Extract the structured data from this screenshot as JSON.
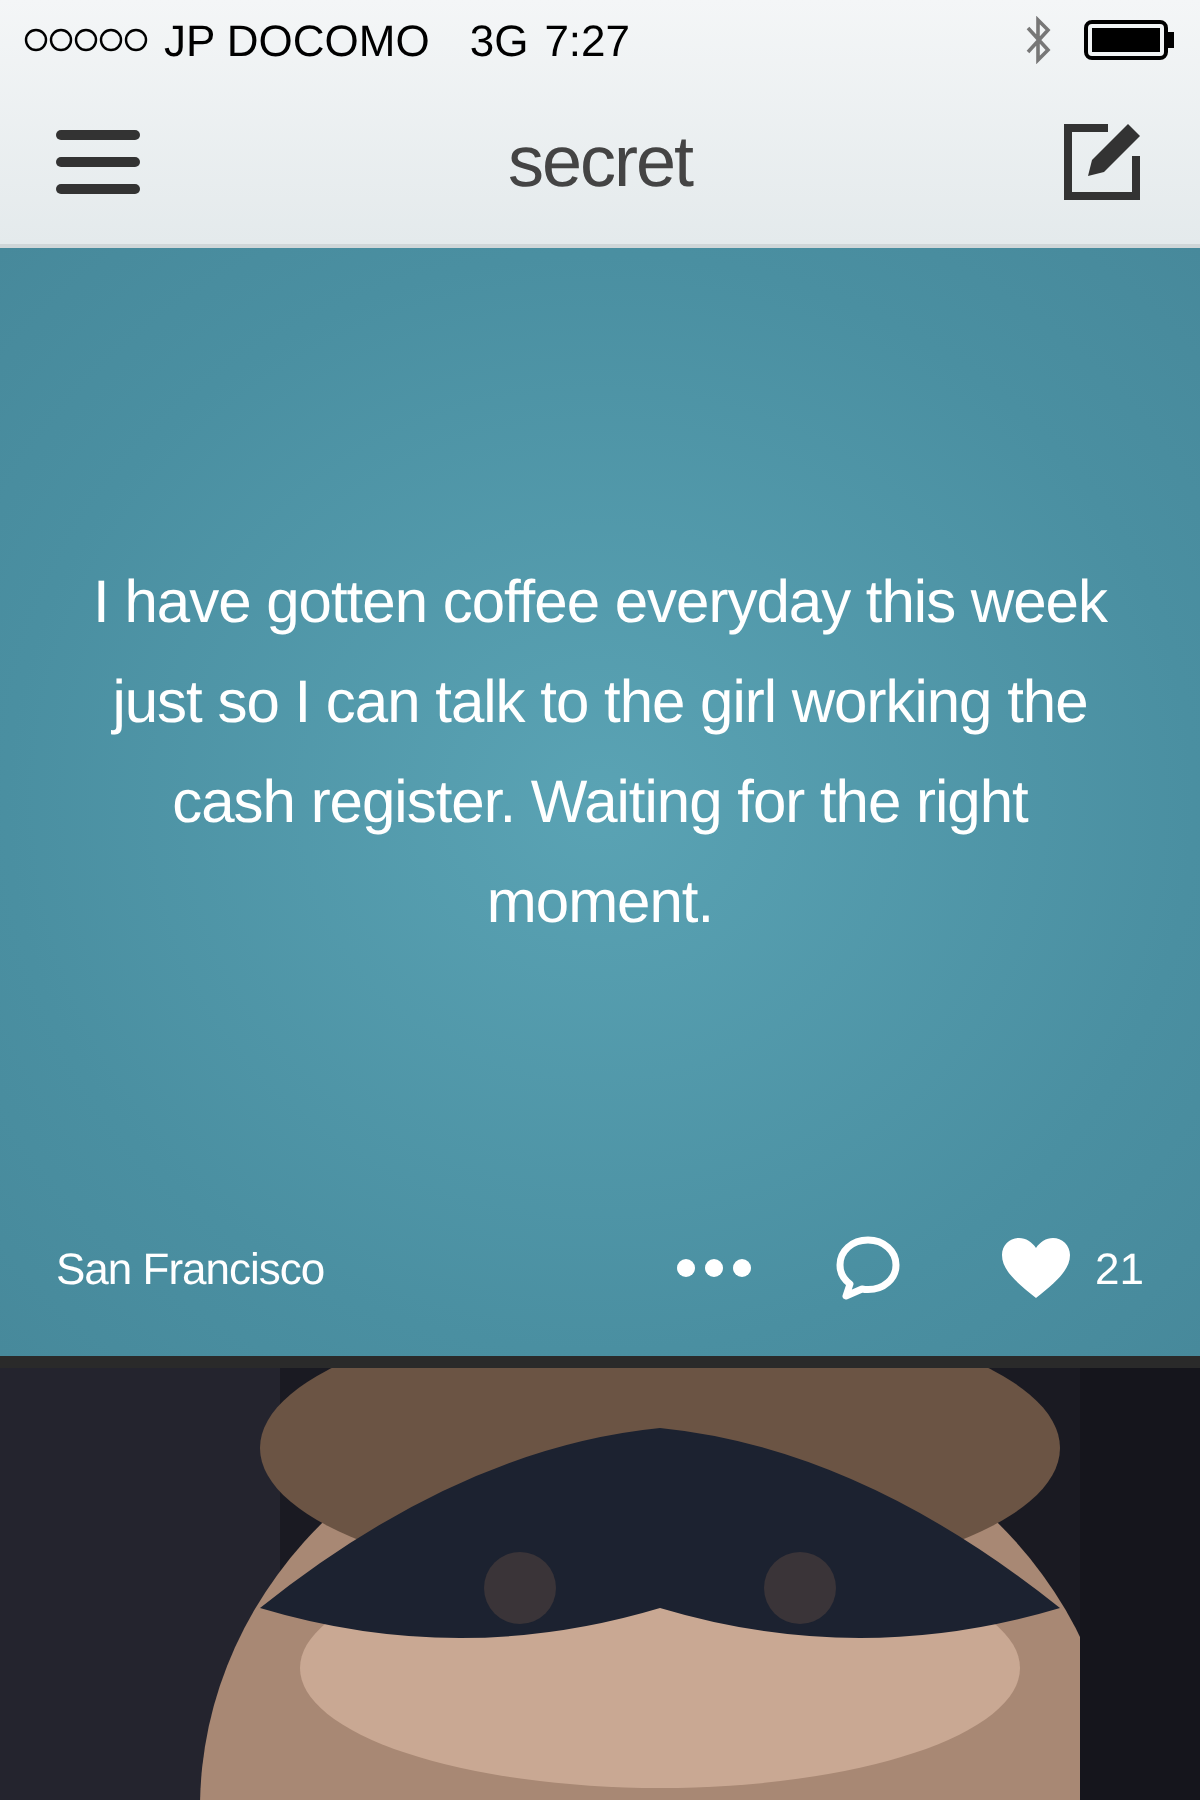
{
  "status_bar": {
    "carrier": "JP DOCOMO",
    "network": "3G",
    "time": "7:27"
  },
  "nav_bar": {
    "title": "secret"
  },
  "posts": [
    {
      "kind": "text",
      "text": "I have gotten coffee everyday this week just so I can talk to the girl working the cash register. Waiting for the right moment.",
      "location": "San Francisco",
      "likes": "21"
    },
    {
      "kind": "picture"
    }
  ]
}
